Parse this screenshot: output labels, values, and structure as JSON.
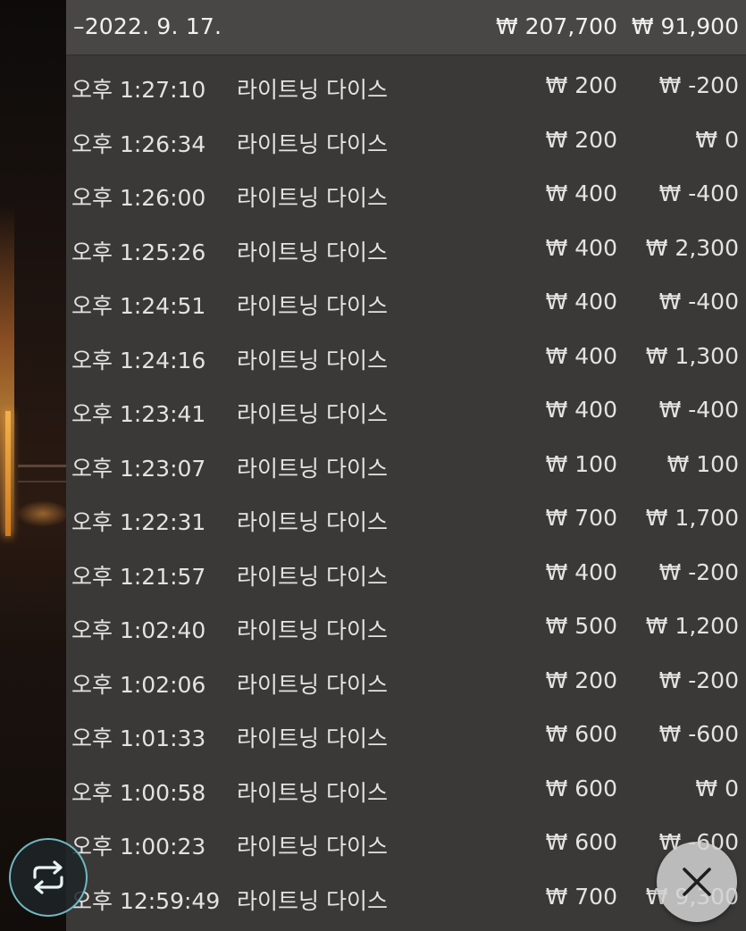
{
  "header": {
    "date": "–2022. 9. 17.",
    "total_bet": "₩ 207,700",
    "total_win": "₩ 91,900"
  },
  "rows": [
    {
      "time": "오후 1:27:10",
      "game": "라이트닝 다이스",
      "bet": "₩ 200",
      "win": "₩ -200"
    },
    {
      "time": "오후 1:26:34",
      "game": "라이트닝 다이스",
      "bet": "₩ 200",
      "win": "₩ 0"
    },
    {
      "time": "오후 1:26:00",
      "game": "라이트닝 다이스",
      "bet": "₩ 400",
      "win": "₩ -400"
    },
    {
      "time": "오후 1:25:26",
      "game": "라이트닝 다이스",
      "bet": "₩ 400",
      "win": "₩ 2,300"
    },
    {
      "time": "오후 1:24:51",
      "game": "라이트닝 다이스",
      "bet": "₩ 400",
      "win": "₩ -400"
    },
    {
      "time": "오후 1:24:16",
      "game": "라이트닝 다이스",
      "bet": "₩ 400",
      "win": "₩ 1,300"
    },
    {
      "time": "오후 1:23:41",
      "game": "라이트닝 다이스",
      "bet": "₩ 400",
      "win": "₩ -400"
    },
    {
      "time": "오후 1:23:07",
      "game": "라이트닝 다이스",
      "bet": "₩ 100",
      "win": "₩ 100"
    },
    {
      "time": "오후 1:22:31",
      "game": "라이트닝 다이스",
      "bet": "₩ 700",
      "win": "₩ 1,700"
    },
    {
      "time": "오후 1:21:57",
      "game": "라이트닝 다이스",
      "bet": "₩ 400",
      "win": "₩ -200"
    },
    {
      "time": "오후 1:02:40",
      "game": "라이트닝 다이스",
      "bet": "₩ 500",
      "win": "₩ 1,200"
    },
    {
      "time": "오후 1:02:06",
      "game": "라이트닝 다이스",
      "bet": "₩ 200",
      "win": "₩ -200"
    },
    {
      "time": "오후 1:01:33",
      "game": "라이트닝 다이스",
      "bet": "₩ 600",
      "win": "₩ -600"
    },
    {
      "time": "오후 1:00:58",
      "game": "라이트닝 다이스",
      "bet": "₩ 600",
      "win": "₩ 0"
    },
    {
      "time": "오후 1:00:23",
      "game": "라이트닝 다이스",
      "bet": "₩ 600",
      "win": "₩ -600"
    },
    {
      "time": "오후 12:59:49",
      "game": "라이트닝 다이스",
      "bet": "₩ 700",
      "win": "₩ 9,300"
    }
  ],
  "icons": {
    "repeat": "repeat-icon",
    "close": "close-icon"
  },
  "colors": {
    "panel_bg": "#3a3938",
    "header_bg": "#484746",
    "text": "#e4e3e1",
    "repeat_ring": "#6fb9c4"
  }
}
